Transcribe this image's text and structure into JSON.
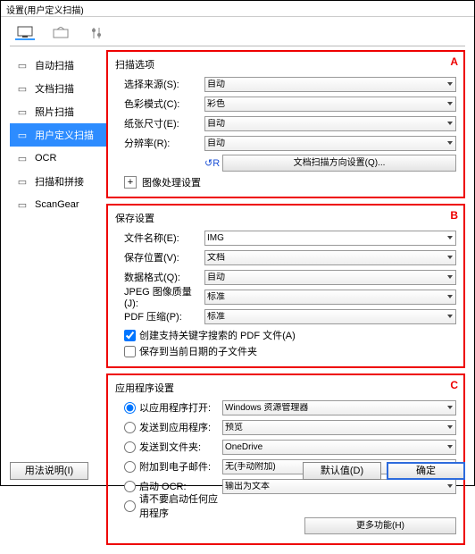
{
  "window": {
    "title": "设置(用户定义扫描)"
  },
  "sidebar": [
    "自动扫描",
    "文档扫描",
    "照片扫描",
    "用户定义扫描",
    "OCR",
    "扫描和拼接",
    "ScanGear"
  ],
  "panels": {
    "a": {
      "tag": "A",
      "title": "扫描选项",
      "rows": [
        {
          "label": "选择来源(S):",
          "value": "自动"
        },
        {
          "label": "色彩模式(C):",
          "value": "彩色"
        },
        {
          "label": "纸张尺寸(E):",
          "value": "自动"
        },
        {
          "label": "分辨率(R):",
          "value": "自动"
        }
      ],
      "rotate_icon": "↺R",
      "orient_btn": "文档扫描方向设置(Q)...",
      "img_proc": "图像处理设置"
    },
    "b": {
      "tag": "B",
      "title": "保存设置",
      "rows": [
        {
          "label": "文件名称(E):",
          "value": "IMG"
        },
        {
          "label": "保存位置(V):",
          "value": "文档"
        },
        {
          "label": "数据格式(Q):",
          "value": "自动"
        },
        {
          "label": "JPEG 图像质量(J):",
          "value": "标准"
        },
        {
          "label": "PDF 压缩(P):",
          "value": "标准"
        }
      ],
      "check1": "创建支持关键字搜索的 PDF 文件(A)",
      "check2": "保存到当前日期的子文件夹"
    },
    "c": {
      "tag": "C",
      "title": "应用程序设置",
      "rows": [
        {
          "label": "以应用程序打开:",
          "value": "Windows 资源管理器"
        },
        {
          "label": "发送到应用程序:",
          "value": "预览"
        },
        {
          "label": "发送到文件夹:",
          "value": "OneDrive"
        },
        {
          "label": "附加到电子邮件:",
          "value": "无(手动附加)"
        },
        {
          "label": "启动 OCR:",
          "value": "输出为文本"
        },
        {
          "label": "请不要启动任何应用程序"
        }
      ],
      "more_btn": "更多功能(H)"
    }
  },
  "footer": {
    "help": "用法说明(I)",
    "defaults": "默认值(D)",
    "ok": "确定"
  }
}
